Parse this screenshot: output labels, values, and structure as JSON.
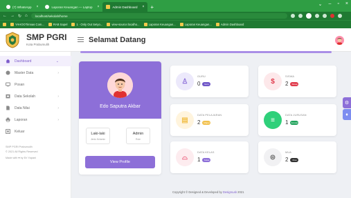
{
  "browser": {
    "tabs": [
      {
        "label": "(7) WhatsApp",
        "active": false
      },
      {
        "label": "Laporan Keuangan — Laptop",
        "active": false
      },
      {
        "label": "Admin Dashboard",
        "active": true
      }
    ],
    "new_tab": "+",
    "url": "localhost/sekolah/home",
    "bookmarks": [
      "YAHOOTimnas Com...",
      "RAB Sapel",
      "1 · Only Out Setyo...",
      "view-source:localho...",
      "Laporan Keuangan...",
      "Laporan Keuangan...",
      "Admin Dashboard"
    ]
  },
  "app": {
    "brand": "SMP PGRI",
    "brand_sub": "Kota Prabumulih",
    "page_title": "Selamat Datang"
  },
  "sidebar": {
    "items": [
      {
        "label": "Dashboard",
        "icon": "home-icon",
        "active": true
      },
      {
        "label": "Master Data",
        "icon": "database-icon",
        "active": false
      },
      {
        "label": "Posan",
        "icon": "computer-icon",
        "active": false
      },
      {
        "label": "Data Sekolah",
        "icon": "school-icon",
        "active": false
      },
      {
        "label": "Data Nilai",
        "icon": "document-icon",
        "active": false
      },
      {
        "label": "Laporan",
        "icon": "print-icon",
        "active": false
      },
      {
        "label": "Keluar",
        "icon": "logout-icon",
        "active": false
      }
    ],
    "footer_line1": "SMP PGRI Prabumulih",
    "footer_line2": "© 2021 All Rights Reserved",
    "footer_line3": "Made with ♥ by Eri Yapani"
  },
  "profile": {
    "name": "Edo Saputra Akbar",
    "gender_value": "Laki-laki",
    "gender_label": "Jenis Kelamin",
    "role_value": "Admin",
    "role_label": "Role",
    "button": "View Profile"
  },
  "cards": [
    {
      "label": "GURU",
      "count": "0",
      "badge": "Guru",
      "icon": "user-icon",
      "icon_glyph": "♙",
      "icon_bg": "#ece9fb",
      "icon_color": "#8d6fd8",
      "badge_color": "#6f56c7"
    },
    {
      "label": "SISWA",
      "count": "2",
      "badge": "Siswa",
      "icon": "dollar-icon",
      "icon_glyph": "$",
      "icon_bg": "#fde8ea",
      "icon_color": "#e03a4b",
      "badge_color": "#e03a4b"
    },
    {
      "label": "DATA PELAJARAN",
      "count": "2",
      "badge": "Mapel",
      "icon": "book-icon",
      "icon_glyph": "▤",
      "icon_bg": "#fff4dd",
      "icon_color": "#f2c14e",
      "badge_color": "#f2c14e"
    },
    {
      "label": "DATA JURUSAN",
      "count": "1",
      "badge": "Jurusan",
      "icon": "list-icon",
      "icon_glyph": "≡",
      "icon_bg": "#2fd07a",
      "icon_color": "#ffffff",
      "badge_color": "#20a35c"
    },
    {
      "label": "DATA KELAS",
      "count": "1",
      "badge": "Kelas",
      "icon": "class-icon",
      "icon_glyph": "⌓",
      "icon_bg": "#fdecef",
      "icon_color": "#ee6a86",
      "badge_color": "#8d6fd8"
    },
    {
      "label": "MUA",
      "count": "2",
      "badge": "Mua",
      "icon": "car-icon",
      "icon_glyph": "⊜",
      "icon_bg": "#f1f1f3",
      "icon_color": "#777777",
      "badge_color": "#333333"
    }
  ],
  "footer": {
    "copyright": "Copyright © Designed & Developed by ",
    "link": "DesignLab",
    "year": " 2021"
  }
}
